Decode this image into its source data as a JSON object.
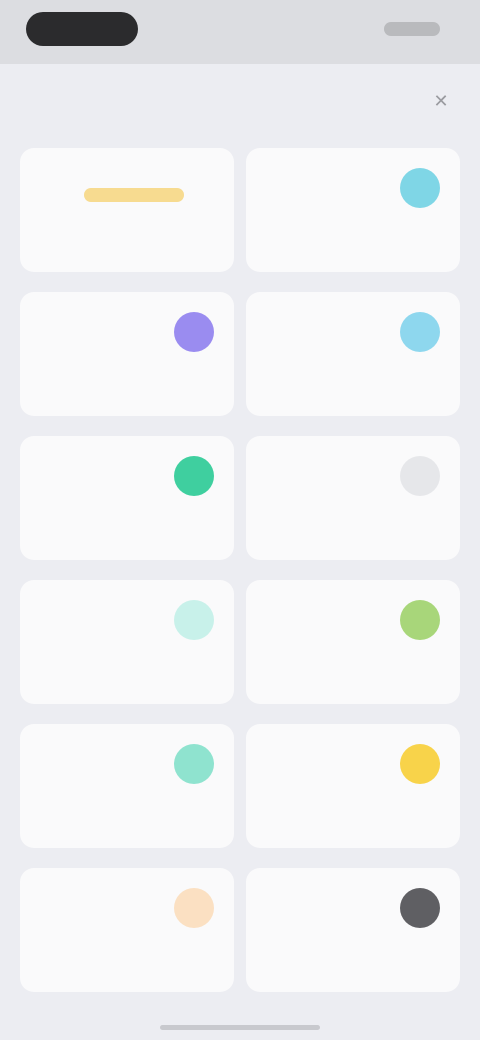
{
  "header": {
    "title": "",
    "action_icon": "close-icon"
  },
  "cards": [
    {
      "title": "",
      "desc": "",
      "icon_color": "",
      "highlight": "#f6d57c"
    },
    {
      "title": "",
      "desc": "",
      "icon_color": "#7fd6e6"
    },
    {
      "title": "",
      "desc": "",
      "icon_color": "#9a8cf0"
    },
    {
      "title": "",
      "desc": "",
      "icon_color": "#8ed7ee"
    },
    {
      "title": "",
      "desc": "",
      "icon_color": "#3fcf9f"
    },
    {
      "title": "",
      "desc": "",
      "icon_color": "#e6e7ea"
    },
    {
      "title": "",
      "desc": "",
      "icon_color": "#c8f1ea"
    },
    {
      "title": "",
      "desc": "",
      "icon_color": "#a8d67a"
    },
    {
      "title": "",
      "desc": "",
      "icon_color": "#8fe3cf"
    },
    {
      "title": "",
      "desc": "",
      "icon_color": "#f8d34a"
    },
    {
      "title": "",
      "desc": "",
      "icon_color": "#fbe0c2"
    },
    {
      "title": "",
      "desc": "",
      "icon_color": "#5f5f63"
    }
  ]
}
